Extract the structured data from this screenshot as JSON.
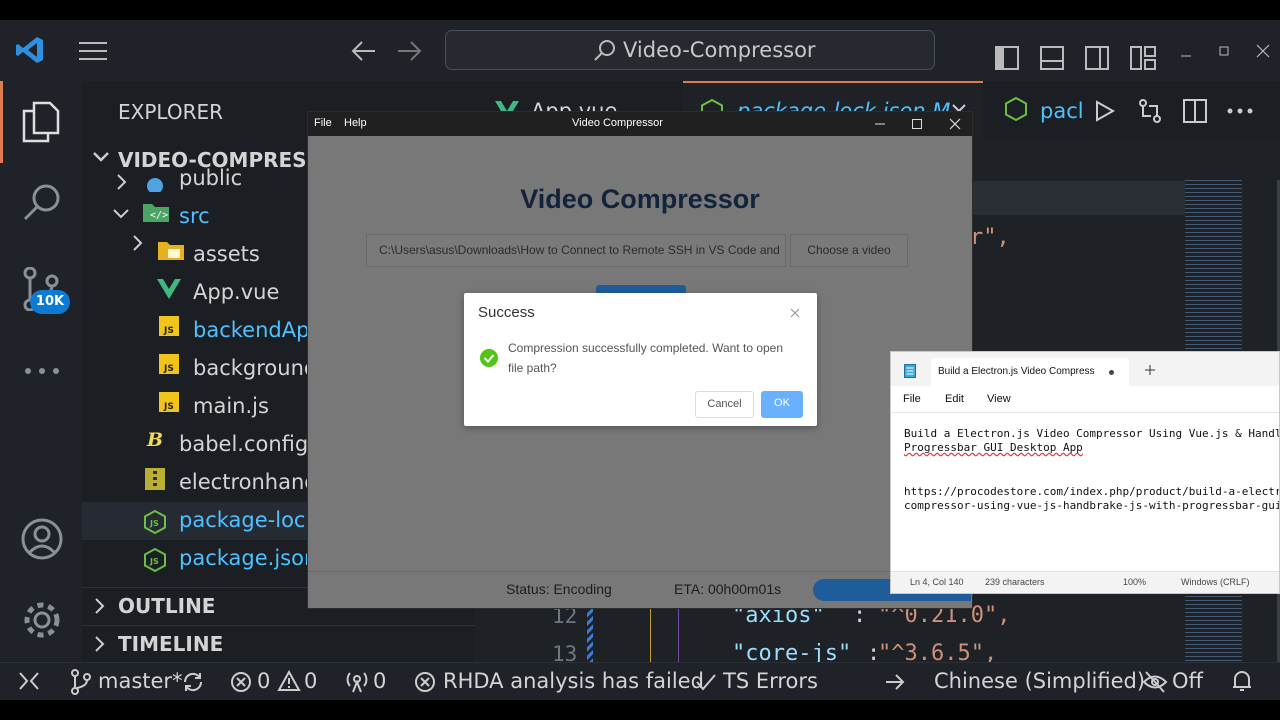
{
  "vscode": {
    "search_text": "Video-Compressor",
    "explorer_title": "EXPLORER",
    "folder_title": "VIDEO-COMPRESSOR",
    "tree": [
      {
        "label": "public",
        "color": "#d4d4d4"
      },
      {
        "label": "src",
        "color": "#4fc1ff"
      },
      {
        "label": "assets",
        "color": "#d4d4d4"
      },
      {
        "label": "App.vue",
        "color": "#d4d4d4"
      },
      {
        "label": "backendApi",
        "color": "#4fc1ff"
      },
      {
        "label": "background",
        "color": "#d4d4d4"
      },
      {
        "label": "main.js",
        "color": "#d4d4d4"
      },
      {
        "label": "babel.config.",
        "color": "#d4d4d4"
      },
      {
        "label": "electronhand",
        "color": "#d4d4d4"
      },
      {
        "label": "package-lock",
        "color": "#4fc1ff"
      },
      {
        "label": "package.json",
        "color": "#4fc1ff"
      }
    ],
    "outline": "OUTLINE",
    "timeline": "TIMELINE",
    "badge": "10K",
    "tabs": [
      {
        "label": "App.vue"
      },
      {
        "label": "package-lock.json M"
      }
    ],
    "tab_overflow": "pacl",
    "code_fragment": "r\",",
    "lines": [
      {
        "num": "12",
        "key": "\"axios\"",
        "value": "\"^0.21.0\","
      },
      {
        "num": "13",
        "key": "\"core-js\"",
        "value": "\"^3.6.5\","
      }
    ],
    "status": {
      "branch": "master*",
      "errors": "0",
      "warnings": "0",
      "ports": "0",
      "rhda": "RHDA analysis has failed",
      "ts": "TS Errors",
      "language": "Chinese (Simplified)",
      "toggle": "Off"
    }
  },
  "app": {
    "menu": [
      "File",
      "Help"
    ],
    "title": "Video Compressor",
    "heading": "Video Compressor",
    "path_value": "C:\\Users\\asus\\Downloads\\How to Connect to Remote SSH in VS Code and",
    "choose_label": "Choose a video",
    "status_label": "Status: Encoding",
    "eta_label": "ETA: 00h00m01s"
  },
  "dialog": {
    "title": "Success",
    "message": "Compression successfully completed. Want to open file path?",
    "cancel": "Cancel",
    "ok": "OK"
  },
  "notepad": {
    "tab_title": "Build a Electron.js Video Compress",
    "menu": [
      "File",
      "Edit",
      "View"
    ],
    "line1": "Build a Electron.js Video Compressor Using Vue.js & Handl",
    "line2": "Progressbar GUI Desktop App",
    "line3": "https://procodestore.com/index.php/product/build-a-electr",
    "line4": "compressor-using-vue-js-handbrake-js-with-progressbar-gui",
    "status": {
      "position": "Ln 4, Col 140",
      "chars": "239 characters",
      "zoom": "100%",
      "encoding": "Windows (CRLF)"
    }
  },
  "colors": {
    "accent": "#4fc1ff",
    "success_green": "#52c41a",
    "ok_blue": "#69b1ff",
    "badge_blue": "#0e7ad1"
  }
}
